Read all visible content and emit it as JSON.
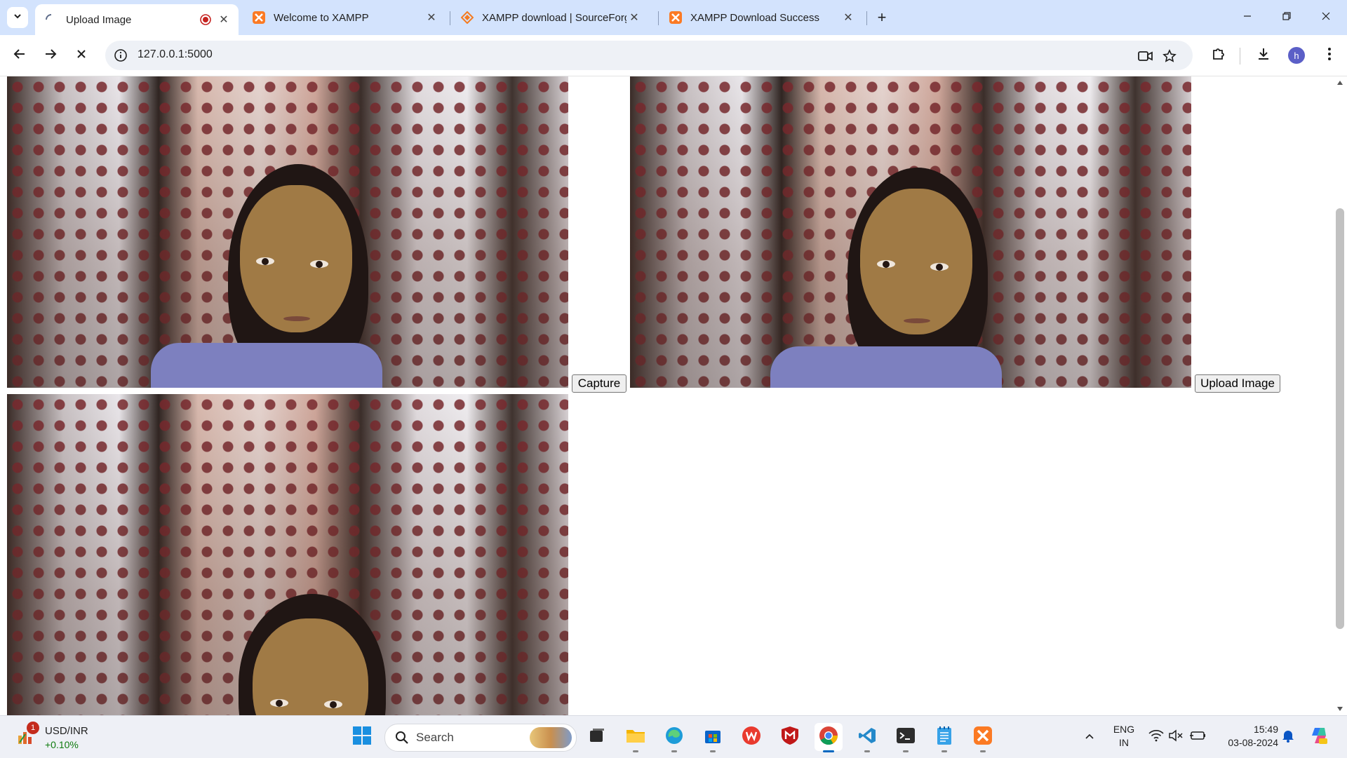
{
  "browser": {
    "tabs": [
      {
        "title": "Upload Image",
        "active": true,
        "favicon": "loading-spinner-icon",
        "recording": true
      },
      {
        "title": "Welcome to XAMPP",
        "active": false,
        "favicon": "xampp-icon"
      },
      {
        "title": "XAMPP download | SourceForge",
        "active": false,
        "favicon": "sourceforge-icon"
      },
      {
        "title": "XAMPP Download Success",
        "active": false,
        "favicon": "xampp-icon"
      }
    ],
    "address": "127.0.0.1:5000",
    "profile_initial": "h",
    "accent_color": "#d3e3fd"
  },
  "page": {
    "capture_label": "Capture",
    "upload_label": "Upload Image"
  },
  "taskbar": {
    "widget_title": "USD/INR",
    "widget_value": "+0.10%",
    "widget_badge": "1",
    "search_placeholder": "Search",
    "language_line1": "ENG",
    "language_line2": "IN",
    "time": "15:49",
    "date": "03-08-2024"
  }
}
